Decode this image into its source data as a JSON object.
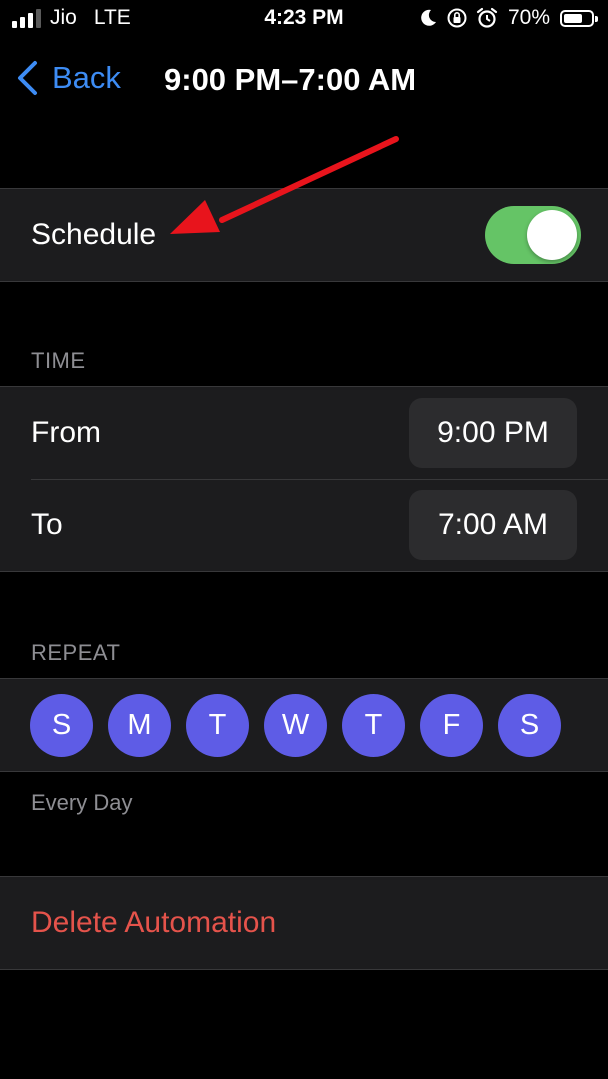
{
  "status_bar": {
    "carrier": "Jio",
    "network": "LTE",
    "time": "4:23 PM",
    "battery_percent": "70%",
    "battery_level": 0.7,
    "signal_bars_active": 3,
    "signal_bars_total": 4,
    "icons": [
      "signal-icon",
      "moon-icon",
      "orientation-lock-icon",
      "alarm-icon",
      "battery-icon"
    ]
  },
  "nav": {
    "back_label": "Back",
    "title": "9:00 PM–7:00 AM"
  },
  "schedule": {
    "label": "Schedule",
    "enabled": true
  },
  "time_section": {
    "header": "TIME",
    "from_label": "From",
    "from_value": "9:00 PM",
    "to_label": "To",
    "to_value": "7:00 AM"
  },
  "repeat_section": {
    "header": "REPEAT",
    "days": [
      "S",
      "M",
      "T",
      "W",
      "T",
      "F",
      "S"
    ],
    "footer": "Every Day"
  },
  "delete": {
    "label": "Delete Automation"
  },
  "colors": {
    "background": "#000000",
    "cell": "#1c1c1e",
    "accent_blue": "#3d8cf4",
    "toggle_green": "#65c466",
    "day_purple": "#5e5ce6",
    "destructive": "#e5534b",
    "annotation_arrow": "#e8141c"
  }
}
